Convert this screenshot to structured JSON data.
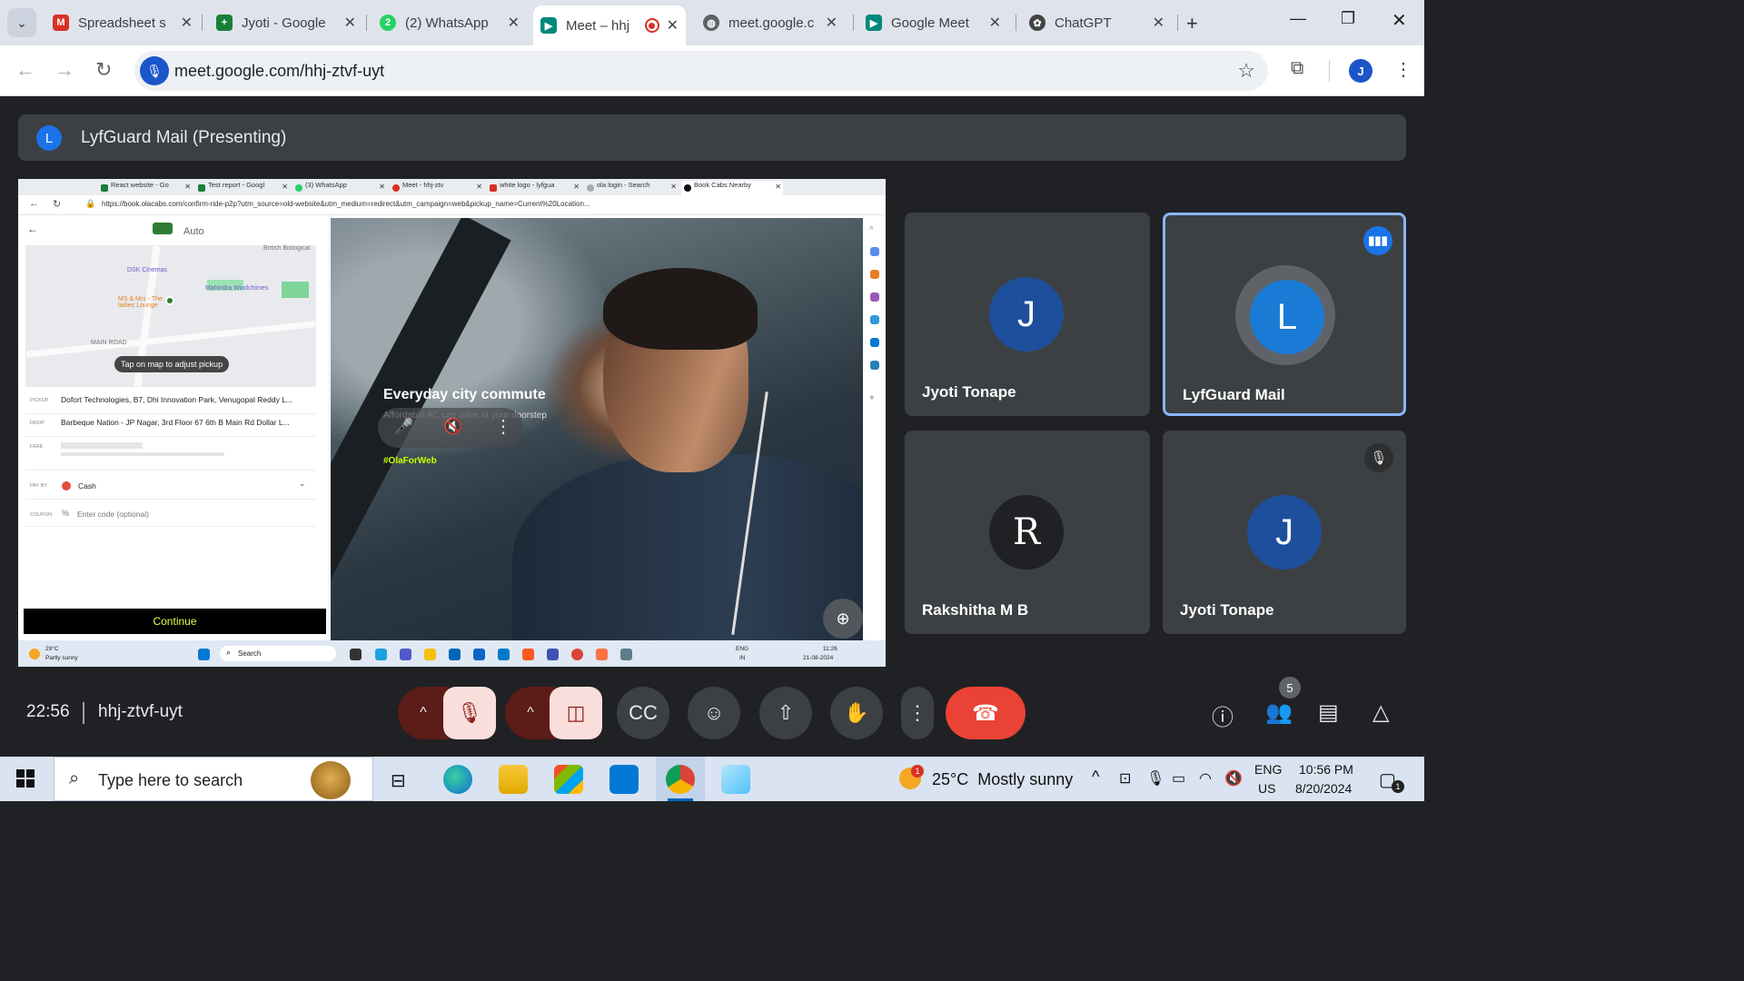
{
  "browser": {
    "tabs": [
      {
        "label": "Spreadsheet s",
        "color": "#d93025"
      },
      {
        "label": "Jyoti - Google",
        "color": "#188038"
      },
      {
        "label": "(2) WhatsApp",
        "color": "#25d366",
        "badge": "2"
      },
      {
        "label": "Meet – hhj",
        "color": "#00897b",
        "active": true,
        "recording": true
      },
      {
        "label": "meet.google.c",
        "color": "#5f6368"
      },
      {
        "label": "Google Meet",
        "color": "#00897b"
      },
      {
        "label": "ChatGPT",
        "color": "#444444"
      }
    ],
    "url": "meet.google.com/hhj-ztvf-uyt",
    "profile_initial": "J"
  },
  "presenting": {
    "avatar_initial": "L",
    "title": "LyfGuard Mail (Presenting)"
  },
  "shared_screen": {
    "tabs": [
      "React website - Go",
      "Test report - Googl",
      "(3) WhatsApp",
      "Meet - hhj-ztv",
      "white logo - lyfgua",
      "ola login - Search",
      "Book Cabs Nearby"
    ],
    "url": "https://book.olacabs.com/confirm-ride-p2p?utm_source=old-website&utm_medium=redirect&utm_campaign=web&pickup_name=Current%20Location...",
    "ride_type": "Auto",
    "map_labels": [
      "DSK Cinemas",
      "Mahindra Windchimes",
      "MS & Mrs - The ladies Lounge",
      "MAIN ROAD",
      "British Biological"
    ],
    "map_tip": "Tap on map to adjust pickup",
    "pickup_label": "PICKUP",
    "pickup": "Dofort Technologies, B7, Dhi Innovation Park, Venugopal Reddy L...",
    "drop_label": "DROP",
    "drop": "Barbeque Nation - JP Nagar, 3rd Floor 67 6th B Main Rd Dollar L...",
    "fare_label": "FARE",
    "payby_label": "PAY BY",
    "payment": "Cash",
    "coupon_label": "COUPON",
    "coupon_placeholder": "Enter code (optional)",
    "continue": "Continue",
    "promo_title": "Everyday city commute",
    "promo_sub": "Affordable AC cab rides at your doorstep",
    "promo_tag": "#OlaForWeb",
    "weather_temp": "29°C",
    "weather_desc": "Partly sunny",
    "taskbar_search": "Search",
    "lang": "ENG",
    "lang2": "IN",
    "time": "11:26",
    "date": "21-08-2024"
  },
  "participants": [
    {
      "name": "Jyoti Tonape",
      "initial": "J",
      "avatar_color": "#1e4f9c"
    },
    {
      "name": "LyfGuard Mail",
      "initial": "L",
      "avatar_color": "#1a7bd6",
      "speaking": true
    },
    {
      "name": "Rakshitha M B",
      "initial": "R",
      "avatar_color": "#202124"
    },
    {
      "name": "Jyoti Tonape",
      "initial": "J",
      "avatar_color": "#1e4f9c",
      "muted": true
    }
  ],
  "meeting": {
    "clock": "22:56",
    "code": "hhj-ztvf-uyt",
    "participant_count": "5"
  },
  "taskbar": {
    "search_placeholder": "Type here to search",
    "weather": "25°C  Mostly sunny",
    "weather_badge": "1",
    "lang": "ENG",
    "region": "US",
    "time": "10:56 PM",
    "date": "8/20/2024",
    "notif_count": "1"
  }
}
